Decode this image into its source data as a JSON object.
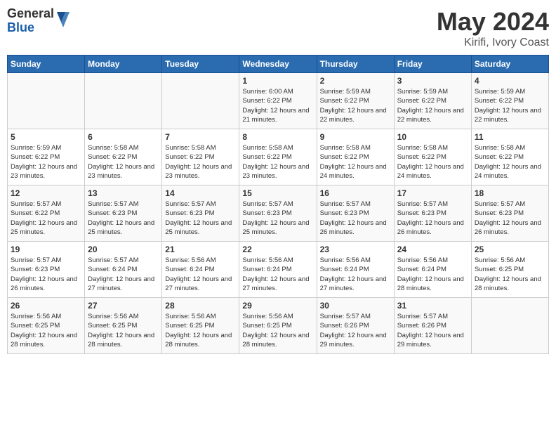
{
  "logo": {
    "general": "General",
    "blue": "Blue"
  },
  "title": "May 2024",
  "subtitle": "Kirifi, Ivory Coast",
  "days_header": [
    "Sunday",
    "Monday",
    "Tuesday",
    "Wednesday",
    "Thursday",
    "Friday",
    "Saturday"
  ],
  "weeks": [
    [
      {
        "day": "",
        "info": ""
      },
      {
        "day": "",
        "info": ""
      },
      {
        "day": "",
        "info": ""
      },
      {
        "day": "1",
        "info": "Sunrise: 6:00 AM\nSunset: 6:22 PM\nDaylight: 12 hours\nand 21 minutes."
      },
      {
        "day": "2",
        "info": "Sunrise: 5:59 AM\nSunset: 6:22 PM\nDaylight: 12 hours\nand 22 minutes."
      },
      {
        "day": "3",
        "info": "Sunrise: 5:59 AM\nSunset: 6:22 PM\nDaylight: 12 hours\nand 22 minutes."
      },
      {
        "day": "4",
        "info": "Sunrise: 5:59 AM\nSunset: 6:22 PM\nDaylight: 12 hours\nand 22 minutes."
      }
    ],
    [
      {
        "day": "5",
        "info": "Sunrise: 5:59 AM\nSunset: 6:22 PM\nDaylight: 12 hours\nand 23 minutes."
      },
      {
        "day": "6",
        "info": "Sunrise: 5:58 AM\nSunset: 6:22 PM\nDaylight: 12 hours\nand 23 minutes."
      },
      {
        "day": "7",
        "info": "Sunrise: 5:58 AM\nSunset: 6:22 PM\nDaylight: 12 hours\nand 23 minutes."
      },
      {
        "day": "8",
        "info": "Sunrise: 5:58 AM\nSunset: 6:22 PM\nDaylight: 12 hours\nand 23 minutes."
      },
      {
        "day": "9",
        "info": "Sunrise: 5:58 AM\nSunset: 6:22 PM\nDaylight: 12 hours\nand 24 minutes."
      },
      {
        "day": "10",
        "info": "Sunrise: 5:58 AM\nSunset: 6:22 PM\nDaylight: 12 hours\nand 24 minutes."
      },
      {
        "day": "11",
        "info": "Sunrise: 5:58 AM\nSunset: 6:22 PM\nDaylight: 12 hours\nand 24 minutes."
      }
    ],
    [
      {
        "day": "12",
        "info": "Sunrise: 5:57 AM\nSunset: 6:22 PM\nDaylight: 12 hours\nand 25 minutes."
      },
      {
        "day": "13",
        "info": "Sunrise: 5:57 AM\nSunset: 6:23 PM\nDaylight: 12 hours\nand 25 minutes."
      },
      {
        "day": "14",
        "info": "Sunrise: 5:57 AM\nSunset: 6:23 PM\nDaylight: 12 hours\nand 25 minutes."
      },
      {
        "day": "15",
        "info": "Sunrise: 5:57 AM\nSunset: 6:23 PM\nDaylight: 12 hours\nand 25 minutes."
      },
      {
        "day": "16",
        "info": "Sunrise: 5:57 AM\nSunset: 6:23 PM\nDaylight: 12 hours\nand 26 minutes."
      },
      {
        "day": "17",
        "info": "Sunrise: 5:57 AM\nSunset: 6:23 PM\nDaylight: 12 hours\nand 26 minutes."
      },
      {
        "day": "18",
        "info": "Sunrise: 5:57 AM\nSunset: 6:23 PM\nDaylight: 12 hours\nand 26 minutes."
      }
    ],
    [
      {
        "day": "19",
        "info": "Sunrise: 5:57 AM\nSunset: 6:23 PM\nDaylight: 12 hours\nand 26 minutes."
      },
      {
        "day": "20",
        "info": "Sunrise: 5:57 AM\nSunset: 6:24 PM\nDaylight: 12 hours\nand 27 minutes."
      },
      {
        "day": "21",
        "info": "Sunrise: 5:56 AM\nSunset: 6:24 PM\nDaylight: 12 hours\nand 27 minutes."
      },
      {
        "day": "22",
        "info": "Sunrise: 5:56 AM\nSunset: 6:24 PM\nDaylight: 12 hours\nand 27 minutes."
      },
      {
        "day": "23",
        "info": "Sunrise: 5:56 AM\nSunset: 6:24 PM\nDaylight: 12 hours\nand 27 minutes."
      },
      {
        "day": "24",
        "info": "Sunrise: 5:56 AM\nSunset: 6:24 PM\nDaylight: 12 hours\nand 28 minutes."
      },
      {
        "day": "25",
        "info": "Sunrise: 5:56 AM\nSunset: 6:25 PM\nDaylight: 12 hours\nand 28 minutes."
      }
    ],
    [
      {
        "day": "26",
        "info": "Sunrise: 5:56 AM\nSunset: 6:25 PM\nDaylight: 12 hours\nand 28 minutes."
      },
      {
        "day": "27",
        "info": "Sunrise: 5:56 AM\nSunset: 6:25 PM\nDaylight: 12 hours\nand 28 minutes."
      },
      {
        "day": "28",
        "info": "Sunrise: 5:56 AM\nSunset: 6:25 PM\nDaylight: 12 hours\nand 28 minutes."
      },
      {
        "day": "29",
        "info": "Sunrise: 5:56 AM\nSunset: 6:25 PM\nDaylight: 12 hours\nand 28 minutes."
      },
      {
        "day": "30",
        "info": "Sunrise: 5:57 AM\nSunset: 6:26 PM\nDaylight: 12 hours\nand 29 minutes."
      },
      {
        "day": "31",
        "info": "Sunrise: 5:57 AM\nSunset: 6:26 PM\nDaylight: 12 hours\nand 29 minutes."
      },
      {
        "day": "",
        "info": ""
      }
    ]
  ]
}
